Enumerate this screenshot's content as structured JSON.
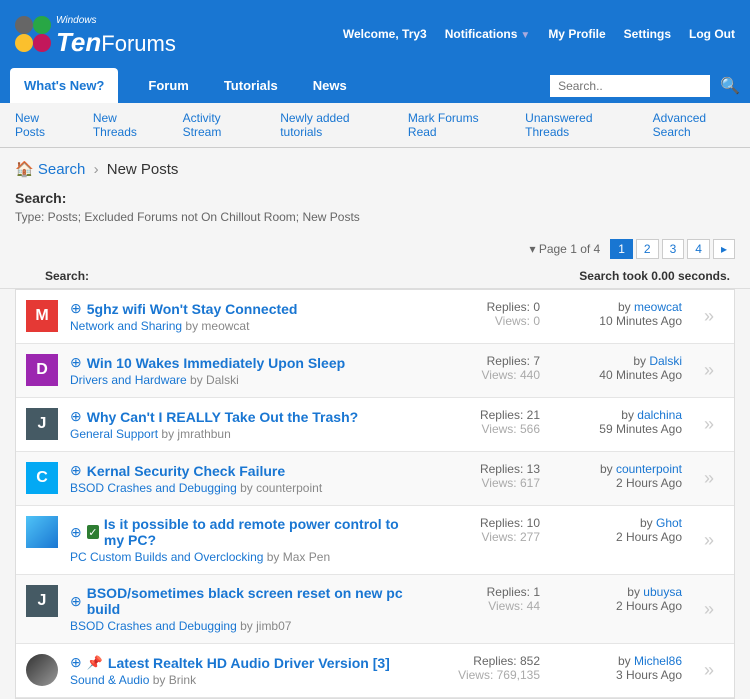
{
  "header": {
    "welcome": "Welcome,",
    "user": "Try3",
    "notifications": "Notifications",
    "profile": "My Profile",
    "settings": "Settings",
    "logout": "Log Out",
    "logo_small": "Windows",
    "logo_ten": "Ten",
    "logo_forums": "Forums"
  },
  "nav": {
    "tabs": [
      {
        "label": "What's New?",
        "active": true
      },
      {
        "label": "Forum"
      },
      {
        "label": "Tutorials"
      },
      {
        "label": "News"
      }
    ],
    "search_placeholder": "Search.."
  },
  "subnav": {
    "items": [
      "New Posts",
      "New Threads",
      "Activity Stream",
      "Newly added tutorials",
      "Mark Forums Read",
      "Unanswered Threads"
    ],
    "right": "Advanced Search"
  },
  "breadcrumb": {
    "search": "Search",
    "current": "New Posts"
  },
  "searchinfo": {
    "title": "Search:",
    "desc": "Type: Posts; Excluded Forums not On Chillout Room; New Posts"
  },
  "pager": {
    "text": "Page 1 of 4",
    "pages": [
      "1",
      "2",
      "3",
      "4"
    ],
    "active": "1"
  },
  "subhead": {
    "left": "Search:",
    "right": "Search took 0.00 seconds."
  },
  "threads": [
    {
      "avatar": "M",
      "avaclass": "ava-M",
      "title": "5ghz wifi Won't Stay Connected",
      "forum": "Network and Sharing",
      "author": "meowcat",
      "replies": "Replies: 0",
      "views": "Views: 0",
      "lastby": "meowcat",
      "lasttime": "10 Minutes Ago",
      "icon": "down"
    },
    {
      "avatar": "D",
      "avaclass": "ava-D",
      "title": "Win 10 Wakes Immediately Upon Sleep",
      "forum": "Drivers and Hardware",
      "author": "Dalski",
      "replies": "Replies: 7",
      "views": "Views: 440",
      "lastby": "Dalski",
      "lasttime": "40 Minutes Ago",
      "icon": "down"
    },
    {
      "avatar": "J",
      "avaclass": "ava-J",
      "title": "Why Can't I REALLY Take Out the Trash?",
      "forum": "General Support",
      "author": "jmrathbun",
      "replies": "Replies: 21",
      "views": "Views: 566",
      "lastby": "dalchina",
      "lasttime": "59 Minutes Ago",
      "icon": "down"
    },
    {
      "avatar": "C",
      "avaclass": "ava-C",
      "title": "Kernal Security Check Failure",
      "forum": "BSOD Crashes and Debugging",
      "author": "counterpoint",
      "replies": "Replies: 13",
      "views": "Views: 617",
      "lastby": "counterpoint",
      "lasttime": "2 Hours Ago",
      "icon": "down"
    },
    {
      "avatar": "",
      "avaclass": "ava-img",
      "title": "Is it possible to add remote power control to my PC?",
      "forum": "PC Custom Builds and Overclocking",
      "author": "Max Pen",
      "replies": "Replies: 10",
      "views": "Views: 277",
      "lastby": "Ghot",
      "lasttime": "2 Hours Ago",
      "icon": "check"
    },
    {
      "avatar": "J",
      "avaclass": "ava-J",
      "title": "BSOD/sometimes black screen reset on new pc build",
      "forum": "BSOD Crashes and Debugging",
      "author": "jimb07",
      "replies": "Replies: 1",
      "views": "Views: 44",
      "lastby": "ubuysa",
      "lasttime": "2 Hours Ago",
      "icon": "down"
    },
    {
      "avatar": "",
      "avaclass": "ava-img2",
      "title": "Latest Realtek HD Audio Driver Version [3]",
      "forum": "Sound & Audio",
      "author": "Brink",
      "replies": "Replies: 852",
      "views": "Views: 769,135",
      "lastby": "Michel86",
      "lasttime": "3 Hours Ago",
      "icon": "pin"
    }
  ]
}
